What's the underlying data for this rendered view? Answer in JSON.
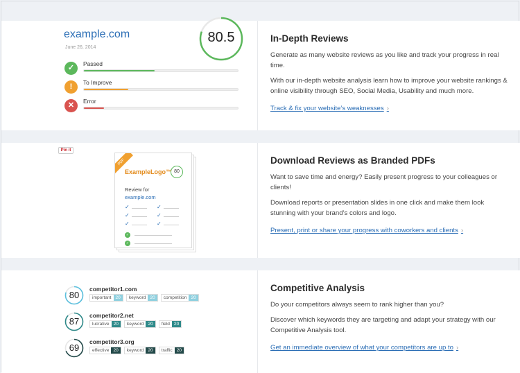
{
  "review": {
    "site": "example.com",
    "date": "June 26, 2014",
    "score": "80.5",
    "score_fraction": 0.805,
    "metrics": [
      {
        "label": "Passed",
        "icon": "check",
        "icon_glyph": "✓",
        "color": "#5cb85c",
        "fill_fraction": 0.46
      },
      {
        "label": "To Improve",
        "icon": "exclamation",
        "icon_glyph": "!",
        "color": "#f0a030",
        "fill_fraction": 0.29
      },
      {
        "label": "Error",
        "icon": "close",
        "icon_glyph": "✕",
        "color": "#d9534f",
        "fill_fraction": 0.13
      }
    ]
  },
  "features": {
    "reviews": {
      "title": "In-Depth Reviews",
      "p1": "Generate as many website reviews as you like and track your progress in real time.",
      "p2": "With our in-depth website analysis learn how to improve your website rankings & online visibility through SEO, Social Media, Usability and much more.",
      "link": "Track & fix your website’s weaknesses",
      "chev": "›"
    },
    "pdf": {
      "title": "Download Reviews as Branded PDFs",
      "p1": "Want to save time and energy?  Easily present progress to your colleagues or clients!",
      "p2": "Download reports or presentation slides in one click and make them look stunning with your brand’s colors and logo.",
      "link": "Present, print or share your progress with coworkers and clients",
      "chev": "›"
    },
    "competitive": {
      "title": "Competitive Analysis",
      "p1": "Do your competitors always seem to rank higher than you?",
      "p2": "Discover which keywords they are targeting and adapt your strategy with our Competitive Analysis tool.",
      "link": "Get an immediate overview of what your competitors are up to",
      "chev": "›"
    }
  },
  "pdf_preview": {
    "pinit": "Pin it",
    "tag": "PDF",
    "logo": "ExampleLogo™",
    "score": "80",
    "review_for": "Review for",
    "site": "example.com",
    "check": "✓"
  },
  "competitors": [
    {
      "score": "80",
      "score_fraction": 0.8,
      "name": "competitor1.com",
      "ring_color": "#5bc0de",
      "tags": [
        {
          "k": "important",
          "v": "20",
          "color": "#8fd0df"
        },
        {
          "k": "keyword",
          "v": "20",
          "color": "#8fd0df"
        },
        {
          "k": "competition",
          "v": "20",
          "color": "#8fd0df"
        }
      ]
    },
    {
      "score": "87",
      "score_fraction": 0.87,
      "name": "competitor2.net",
      "ring_color": "#2f8a8a",
      "tags": [
        {
          "k": "lucrative",
          "v": "20",
          "color": "#2f8a8a"
        },
        {
          "k": "keyword",
          "v": "20",
          "color": "#2f8a8a"
        },
        {
          "k": "field",
          "v": "20",
          "color": "#2f8a8a"
        }
      ]
    },
    {
      "score": "69",
      "score_fraction": 0.69,
      "name": "competitor3.org",
      "ring_color": "#234a4a",
      "tags": [
        {
          "k": "effective",
          "v": "20",
          "color": "#234a4a"
        },
        {
          "k": "keyword",
          "v": "20",
          "color": "#234a4a"
        },
        {
          "k": "traffic",
          "v": "20",
          "color": "#234a4a"
        }
      ]
    }
  ]
}
